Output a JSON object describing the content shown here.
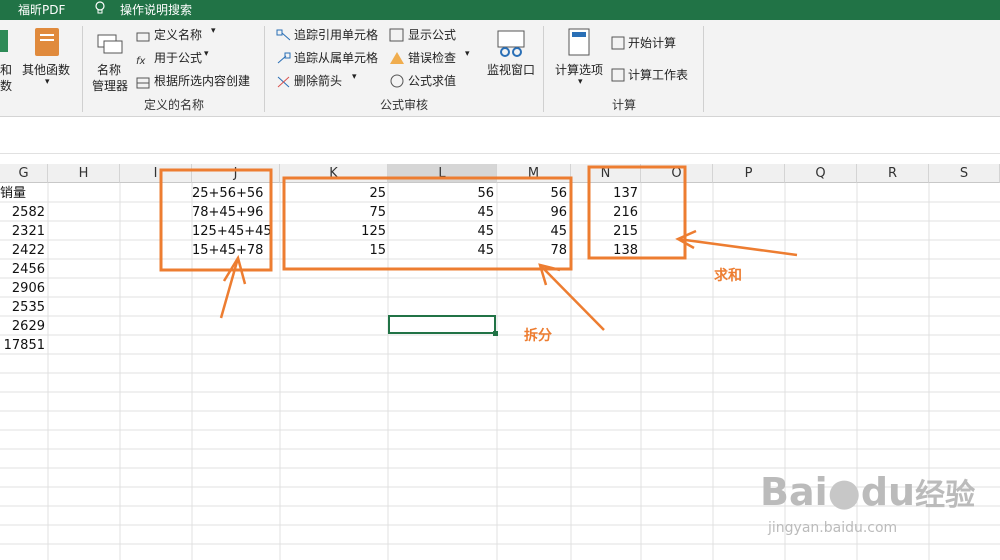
{
  "titlebar": {
    "pdf_tab": "福昕PDF",
    "search_tab": "操作说明搜索"
  },
  "ribbon": {
    "partial_left_1": "和",
    "partial_left_2": "数",
    "other_functions": "其他函数",
    "name_manager_line1": "名称",
    "name_manager_line2": "管理器",
    "define_name": "定义名称",
    "use_in_formula": "用于公式",
    "create_from_selection": "根据所选内容创建",
    "group_defined_names": "定义的名称",
    "trace_precedents": "追踪引用单元格",
    "trace_dependents": "追踪从属单元格",
    "remove_arrows": "删除箭头",
    "show_formulas": "显示公式",
    "error_checking": "错误检查",
    "evaluate_formula": "公式求值",
    "watch_window": "监视窗口",
    "group_formula_auditing": "公式审核",
    "calc_options": "计算选项",
    "calc_now": "开始计算",
    "calc_sheet": "计算工作表",
    "group_calculation": "计算"
  },
  "columns": [
    "G",
    "H",
    "I",
    "J",
    "K",
    "L",
    "M",
    "N",
    "O",
    "P",
    "Q",
    "R",
    "S"
  ],
  "col_g": [
    "销量",
    "2582",
    "2321",
    "2422",
    "2456",
    "2906",
    "2535",
    "2629",
    "17851"
  ],
  "col_j": [
    "25+56+56",
    "78+45+96",
    "125+45+45",
    "15+45+78"
  ],
  "col_k": [
    "25",
    "75",
    "125",
    "15"
  ],
  "col_l": [
    "56",
    "45",
    "45",
    "45"
  ],
  "col_m": [
    "56",
    "96",
    "45",
    "78"
  ],
  "col_n": [
    "137",
    "216",
    "215",
    "138"
  ],
  "annotations": {
    "split": "拆分",
    "sum": "求和"
  },
  "watermark": {
    "brand": "Bai",
    "brand2": "du",
    "brand3": "经验",
    "url": "jingyan.baidu.com"
  },
  "colors": {
    "accent": "#217346",
    "annotation": "#ed7d31"
  }
}
